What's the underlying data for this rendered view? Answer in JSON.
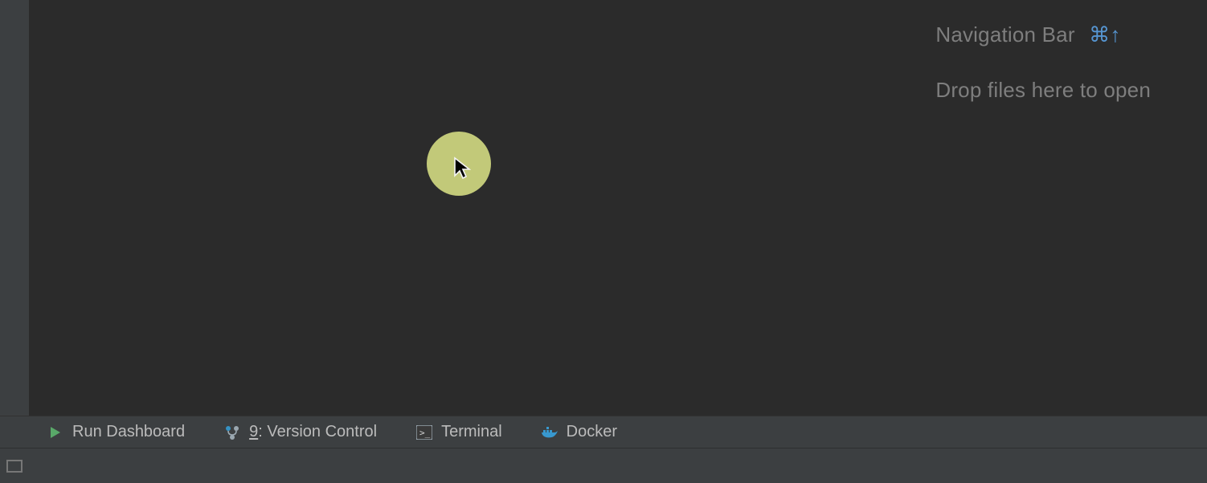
{
  "hints": {
    "navbar_label": "Navigation Bar",
    "navbar_shortcut": "⌘↑",
    "drop_label": "Drop files here to open"
  },
  "toolwindows": {
    "run_dashboard": "Run Dashboard",
    "vcs_prefix": "9",
    "vcs_label": ": Version Control",
    "terminal": "Terminal",
    "docker": "Docker"
  },
  "icons": {
    "play": "play-icon",
    "branch": "branch-icon",
    "terminal": "terminal-icon",
    "docker": "docker-icon",
    "status": "status-rect-icon",
    "cursor": "cursor-arrow-icon"
  }
}
